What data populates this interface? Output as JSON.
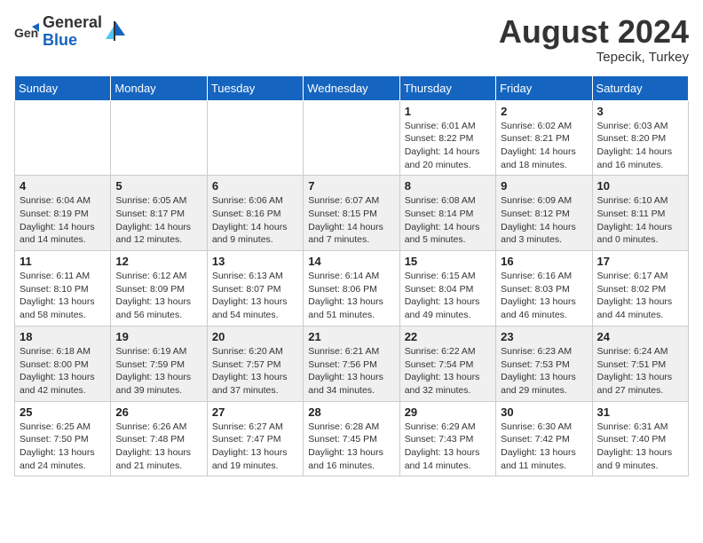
{
  "header": {
    "logo_general": "General",
    "logo_blue": "Blue",
    "month_title": "August 2024",
    "subtitle": "Tepecik, Turkey"
  },
  "days_of_week": [
    "Sunday",
    "Monday",
    "Tuesday",
    "Wednesday",
    "Thursday",
    "Friday",
    "Saturday"
  ],
  "weeks": [
    [
      {
        "day": "",
        "info": ""
      },
      {
        "day": "",
        "info": ""
      },
      {
        "day": "",
        "info": ""
      },
      {
        "day": "",
        "info": ""
      },
      {
        "day": "1",
        "sunrise": "Sunrise: 6:01 AM",
        "sunset": "Sunset: 8:22 PM",
        "daylight": "Daylight: 14 hours and 20 minutes."
      },
      {
        "day": "2",
        "sunrise": "Sunrise: 6:02 AM",
        "sunset": "Sunset: 8:21 PM",
        "daylight": "Daylight: 14 hours and 18 minutes."
      },
      {
        "day": "3",
        "sunrise": "Sunrise: 6:03 AM",
        "sunset": "Sunset: 8:20 PM",
        "daylight": "Daylight: 14 hours and 16 minutes."
      }
    ],
    [
      {
        "day": "4",
        "sunrise": "Sunrise: 6:04 AM",
        "sunset": "Sunset: 8:19 PM",
        "daylight": "Daylight: 14 hours and 14 minutes."
      },
      {
        "day": "5",
        "sunrise": "Sunrise: 6:05 AM",
        "sunset": "Sunset: 8:17 PM",
        "daylight": "Daylight: 14 hours and 12 minutes."
      },
      {
        "day": "6",
        "sunrise": "Sunrise: 6:06 AM",
        "sunset": "Sunset: 8:16 PM",
        "daylight": "Daylight: 14 hours and 9 minutes."
      },
      {
        "day": "7",
        "sunrise": "Sunrise: 6:07 AM",
        "sunset": "Sunset: 8:15 PM",
        "daylight": "Daylight: 14 hours and 7 minutes."
      },
      {
        "day": "8",
        "sunrise": "Sunrise: 6:08 AM",
        "sunset": "Sunset: 8:14 PM",
        "daylight": "Daylight: 14 hours and 5 minutes."
      },
      {
        "day": "9",
        "sunrise": "Sunrise: 6:09 AM",
        "sunset": "Sunset: 8:12 PM",
        "daylight": "Daylight: 14 hours and 3 minutes."
      },
      {
        "day": "10",
        "sunrise": "Sunrise: 6:10 AM",
        "sunset": "Sunset: 8:11 PM",
        "daylight": "Daylight: 14 hours and 0 minutes."
      }
    ],
    [
      {
        "day": "11",
        "sunrise": "Sunrise: 6:11 AM",
        "sunset": "Sunset: 8:10 PM",
        "daylight": "Daylight: 13 hours and 58 minutes."
      },
      {
        "day": "12",
        "sunrise": "Sunrise: 6:12 AM",
        "sunset": "Sunset: 8:09 PM",
        "daylight": "Daylight: 13 hours and 56 minutes."
      },
      {
        "day": "13",
        "sunrise": "Sunrise: 6:13 AM",
        "sunset": "Sunset: 8:07 PM",
        "daylight": "Daylight: 13 hours and 54 minutes."
      },
      {
        "day": "14",
        "sunrise": "Sunrise: 6:14 AM",
        "sunset": "Sunset: 8:06 PM",
        "daylight": "Daylight: 13 hours and 51 minutes."
      },
      {
        "day": "15",
        "sunrise": "Sunrise: 6:15 AM",
        "sunset": "Sunset: 8:04 PM",
        "daylight": "Daylight: 13 hours and 49 minutes."
      },
      {
        "day": "16",
        "sunrise": "Sunrise: 6:16 AM",
        "sunset": "Sunset: 8:03 PM",
        "daylight": "Daylight: 13 hours and 46 minutes."
      },
      {
        "day": "17",
        "sunrise": "Sunrise: 6:17 AM",
        "sunset": "Sunset: 8:02 PM",
        "daylight": "Daylight: 13 hours and 44 minutes."
      }
    ],
    [
      {
        "day": "18",
        "sunrise": "Sunrise: 6:18 AM",
        "sunset": "Sunset: 8:00 PM",
        "daylight": "Daylight: 13 hours and 42 minutes."
      },
      {
        "day": "19",
        "sunrise": "Sunrise: 6:19 AM",
        "sunset": "Sunset: 7:59 PM",
        "daylight": "Daylight: 13 hours and 39 minutes."
      },
      {
        "day": "20",
        "sunrise": "Sunrise: 6:20 AM",
        "sunset": "Sunset: 7:57 PM",
        "daylight": "Daylight: 13 hours and 37 minutes."
      },
      {
        "day": "21",
        "sunrise": "Sunrise: 6:21 AM",
        "sunset": "Sunset: 7:56 PM",
        "daylight": "Daylight: 13 hours and 34 minutes."
      },
      {
        "day": "22",
        "sunrise": "Sunrise: 6:22 AM",
        "sunset": "Sunset: 7:54 PM",
        "daylight": "Daylight: 13 hours and 32 minutes."
      },
      {
        "day": "23",
        "sunrise": "Sunrise: 6:23 AM",
        "sunset": "Sunset: 7:53 PM",
        "daylight": "Daylight: 13 hours and 29 minutes."
      },
      {
        "day": "24",
        "sunrise": "Sunrise: 6:24 AM",
        "sunset": "Sunset: 7:51 PM",
        "daylight": "Daylight: 13 hours and 27 minutes."
      }
    ],
    [
      {
        "day": "25",
        "sunrise": "Sunrise: 6:25 AM",
        "sunset": "Sunset: 7:50 PM",
        "daylight": "Daylight: 13 hours and 24 minutes."
      },
      {
        "day": "26",
        "sunrise": "Sunrise: 6:26 AM",
        "sunset": "Sunset: 7:48 PM",
        "daylight": "Daylight: 13 hours and 21 minutes."
      },
      {
        "day": "27",
        "sunrise": "Sunrise: 6:27 AM",
        "sunset": "Sunset: 7:47 PM",
        "daylight": "Daylight: 13 hours and 19 minutes."
      },
      {
        "day": "28",
        "sunrise": "Sunrise: 6:28 AM",
        "sunset": "Sunset: 7:45 PM",
        "daylight": "Daylight: 13 hours and 16 minutes."
      },
      {
        "day": "29",
        "sunrise": "Sunrise: 6:29 AM",
        "sunset": "Sunset: 7:43 PM",
        "daylight": "Daylight: 13 hours and 14 minutes."
      },
      {
        "day": "30",
        "sunrise": "Sunrise: 6:30 AM",
        "sunset": "Sunset: 7:42 PM",
        "daylight": "Daylight: 13 hours and 11 minutes."
      },
      {
        "day": "31",
        "sunrise": "Sunrise: 6:31 AM",
        "sunset": "Sunset: 7:40 PM",
        "daylight": "Daylight: 13 hours and 9 minutes."
      }
    ]
  ]
}
